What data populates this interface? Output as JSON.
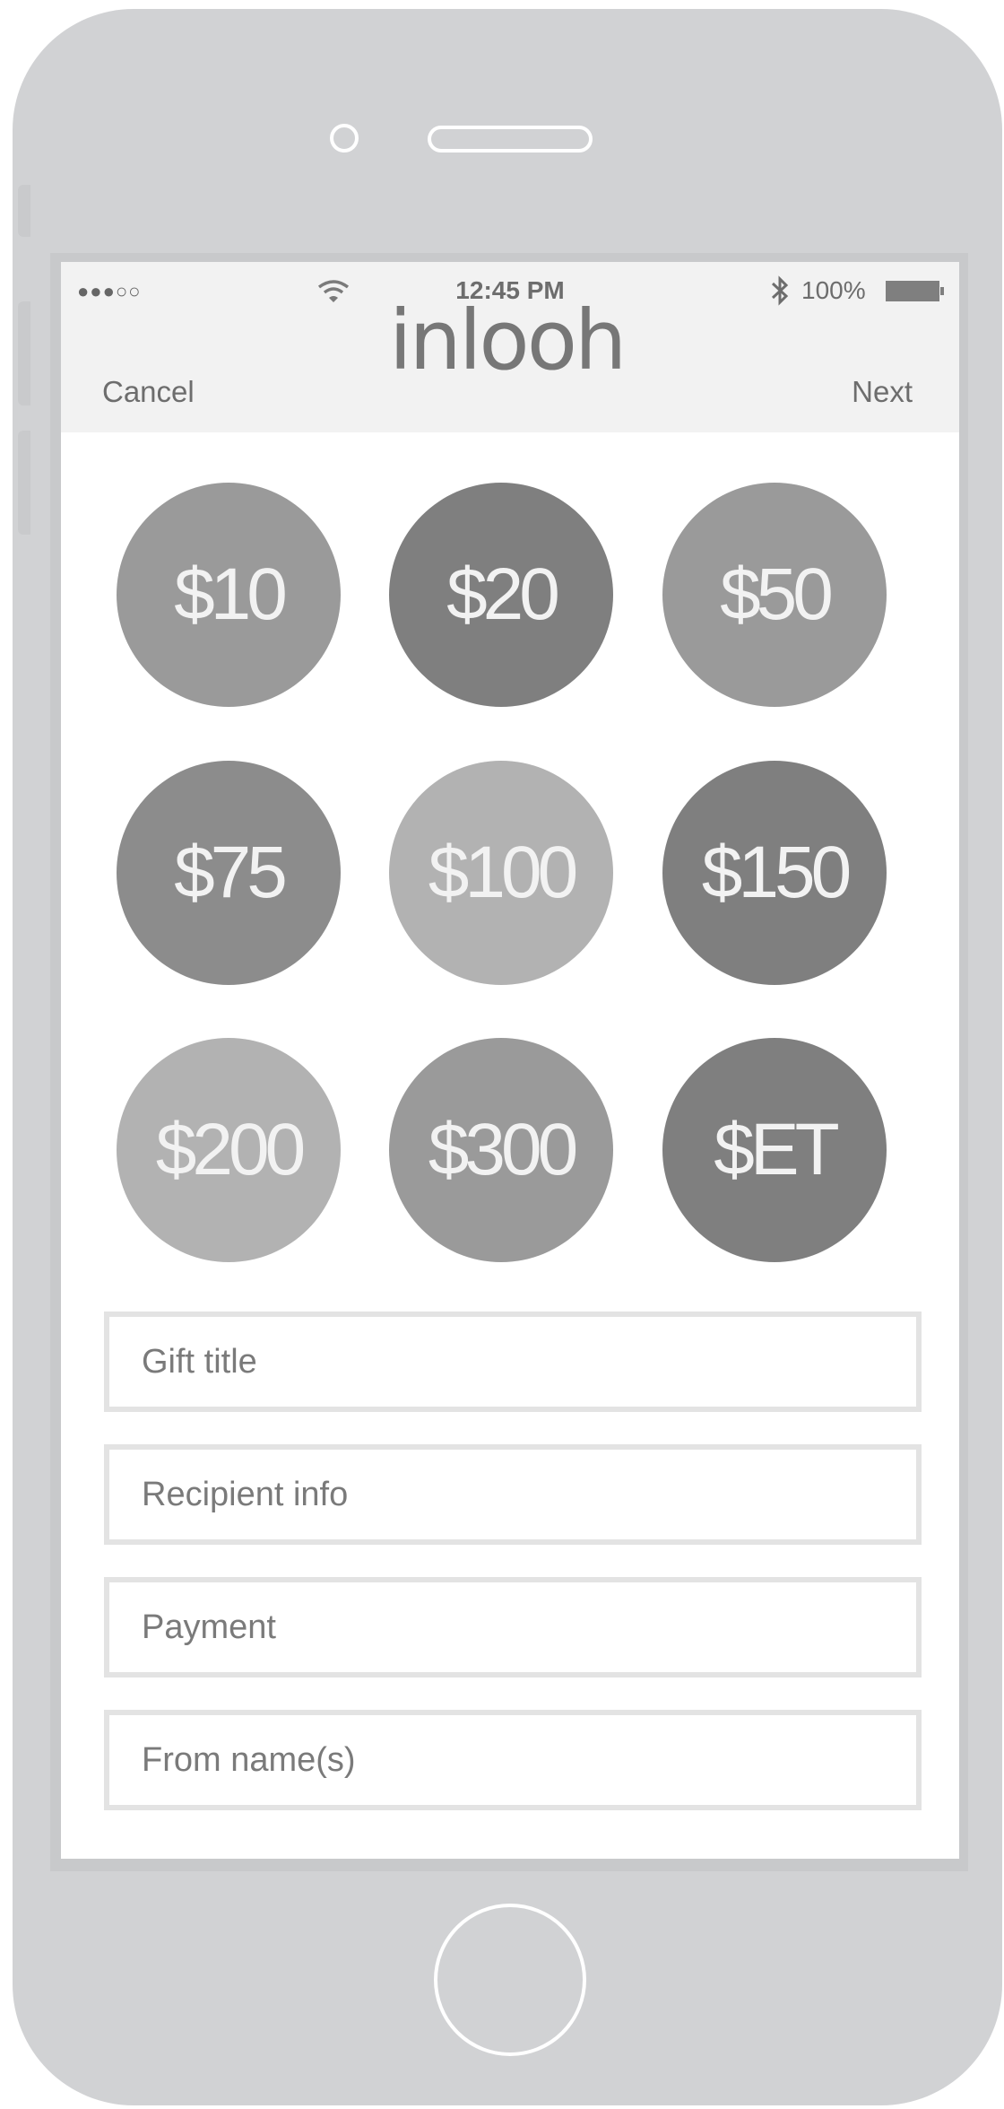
{
  "status_bar": {
    "signal": "●●●○○",
    "time": "12:45 PM",
    "battery_percent": "100%",
    "icons": [
      "wifi-icon",
      "bluetooth-icon",
      "battery-icon"
    ]
  },
  "header": {
    "logo": "inlooh",
    "cancel_label": "Cancel",
    "next_label": "Next"
  },
  "amounts": [
    {
      "label": "$10",
      "color": "#9a9a9a"
    },
    {
      "label": "$20",
      "color": "#7f7f7f"
    },
    {
      "label": "$50",
      "color": "#9a9a9a"
    },
    {
      "label": "$75",
      "color": "#8c8c8c"
    },
    {
      "label": "$100",
      "color": "#b2b2b2"
    },
    {
      "label": "$150",
      "color": "#7f7f7f"
    },
    {
      "label": "$200",
      "color": "#b2b2b2"
    },
    {
      "label": "$300",
      "color": "#9a9a9a"
    },
    {
      "label": "$ET",
      "color": "#7f7f7f"
    }
  ],
  "form": {
    "gift_title_placeholder": "Gift title",
    "recipient_placeholder": "Recipient info",
    "payment_placeholder": "Payment",
    "from_placeholder": "From name(s)"
  },
  "colors": {
    "device": "#d1d2d4",
    "header_bg": "#f2f2f2",
    "text": "#6d6d6d"
  }
}
